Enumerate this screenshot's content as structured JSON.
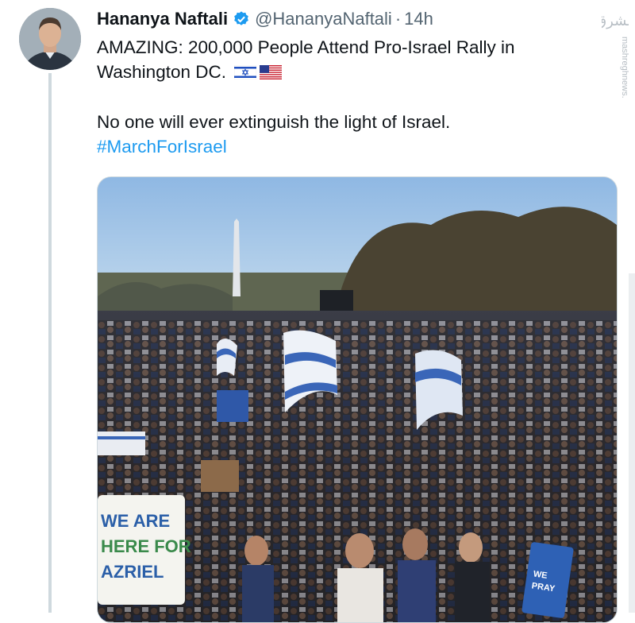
{
  "tweet": {
    "author_name": "Hananya Naftali",
    "handle": "@HananyaNaftali",
    "separator": "·",
    "time": "14h",
    "text_line1": "AMAZING: 200,000 People Attend Pro-Israel Rally in Washington DC.",
    "text_line2": "No one will ever extinguish the light of Israel.",
    "hashtag": "#MarchForIsrael",
    "flags": [
      "israel-flag-emoji",
      "us-flag-emoji"
    ]
  },
  "media": {
    "sign_left": "WE ARE HERE FOR AZRIEL",
    "sign_right": "WE PRAY"
  },
  "watermark": {
    "text": "mashreghnews.ir"
  },
  "colors": {
    "link": "#1d9bf0",
    "verified": "#1d9bf0",
    "secondary_text": "#536471",
    "sky": "#9ec3e6"
  }
}
